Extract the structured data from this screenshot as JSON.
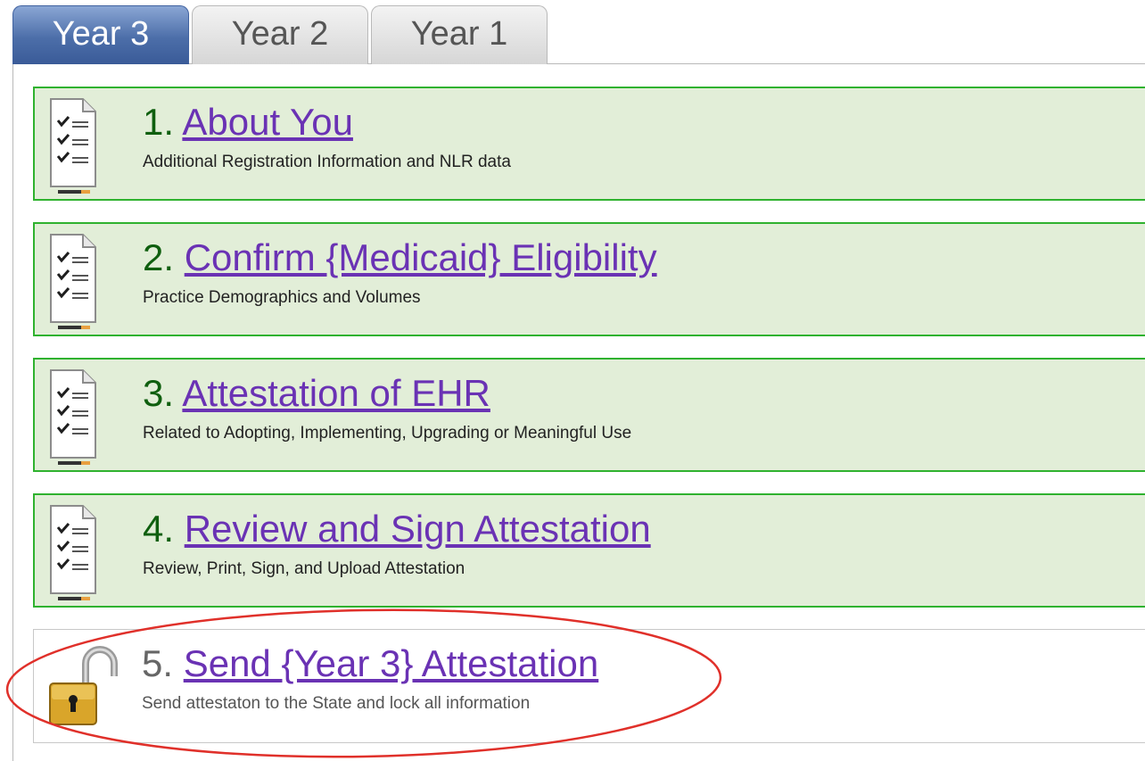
{
  "tabs": [
    {
      "label": "Year 3",
      "active": true
    },
    {
      "label": "Year 2",
      "active": false
    },
    {
      "label": "Year 1",
      "active": false
    }
  ],
  "steps": [
    {
      "number": "1.",
      "title": "About You",
      "subtitle": "Additional Registration Information and NLR data",
      "status": "complete",
      "icon": "checklist-icon"
    },
    {
      "number": "2.",
      "title": "Confirm {Medicaid} Eligibility",
      "subtitle": "Practice Demographics and Volumes",
      "status": "complete",
      "icon": "checklist-icon"
    },
    {
      "number": "3.",
      "title": "Attestation of EHR",
      "subtitle": "Related to Adopting, Implementing, Upgrading or Meaningful Use",
      "status": "complete",
      "icon": "checklist-icon"
    },
    {
      "number": "4.",
      "title": "Review and Sign Attestation",
      "subtitle": "Review, Print, Sign, and Upload Attestation",
      "status": "complete",
      "icon": "checklist-icon"
    },
    {
      "number": "5.",
      "title": "Send {Year 3} Attestation",
      "subtitle": "Send attestaton to the State and lock all information",
      "status": "pending",
      "icon": "unlocked-padlock-icon"
    }
  ],
  "colors": {
    "complete_background": "#e2eed8",
    "complete_border": "#2fb22f",
    "link": "#6a32b4",
    "active_tab": "#4c6ea9",
    "annotation_ellipse": "#e0302a"
  }
}
